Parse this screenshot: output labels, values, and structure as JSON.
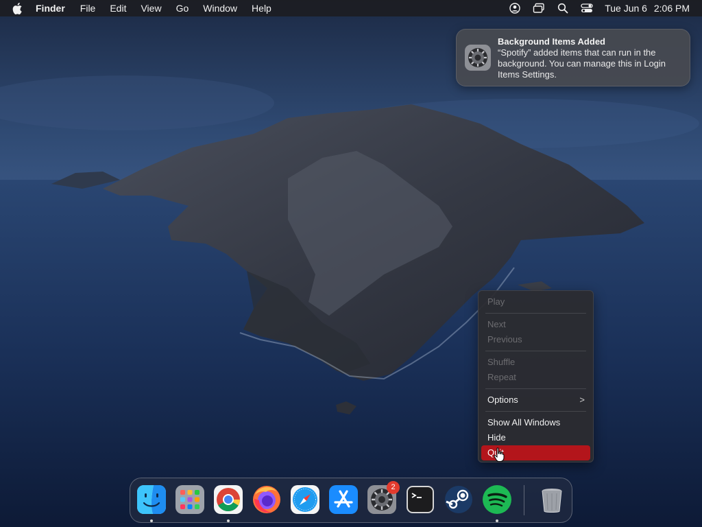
{
  "menubar": {
    "app_name": "Finder",
    "menus": [
      "File",
      "Edit",
      "View",
      "Go",
      "Window",
      "Help"
    ],
    "clock": {
      "date": "Tue Jun 6",
      "time": "2:06 PM"
    },
    "status_icons": [
      "user-icon",
      "screen-mirroring-icon",
      "spotlight-search-icon",
      "control-center-icon"
    ]
  },
  "notification": {
    "title": "Background Items Added",
    "body": "“Spotify” added items that can run in the background. You can manage this in Login Items Settings.",
    "icon": "system-settings-icon"
  },
  "context_menu": {
    "items": [
      {
        "label": "Play",
        "enabled": false
      },
      {
        "label": "Next",
        "enabled": false
      },
      {
        "label": "Previous",
        "enabled": false
      },
      {
        "label": "Shuffle",
        "enabled": false
      },
      {
        "label": "Repeat",
        "enabled": false
      },
      {
        "label": "Options",
        "enabled": true,
        "submenu_arrow": ">"
      },
      {
        "label": "Show All Windows",
        "enabled": true
      },
      {
        "label": "Hide",
        "enabled": true
      },
      {
        "label": "Quit",
        "enabled": true,
        "highlighted": true
      }
    ],
    "highlight_color": "#b3151b"
  },
  "dock": {
    "apps": [
      {
        "name": "Finder",
        "icon": "finder-icon",
        "running": true
      },
      {
        "name": "Launchpad",
        "icon": "launchpad-icon",
        "running": false
      },
      {
        "name": "Google Chrome",
        "icon": "chrome-icon",
        "running": true
      },
      {
        "name": "Firefox",
        "icon": "firefox-icon",
        "running": false
      },
      {
        "name": "Safari",
        "icon": "safari-icon",
        "running": false
      },
      {
        "name": "App Store",
        "icon": "app-store-icon",
        "running": false
      },
      {
        "name": "System Settings",
        "icon": "system-settings-icon",
        "running": false,
        "badge": "2"
      },
      {
        "name": "Terminal",
        "icon": "terminal-icon",
        "running": false
      },
      {
        "name": "Steam",
        "icon": "steam-icon",
        "running": false
      },
      {
        "name": "Spotify",
        "icon": "spotify-icon",
        "running": true
      }
    ],
    "trash": {
      "name": "Trash",
      "icon": "trash-icon"
    }
  },
  "colors": {
    "menubar_bg": "#1c1c20",
    "badge": "#e23b2e",
    "spotify_green": "#1db954"
  }
}
